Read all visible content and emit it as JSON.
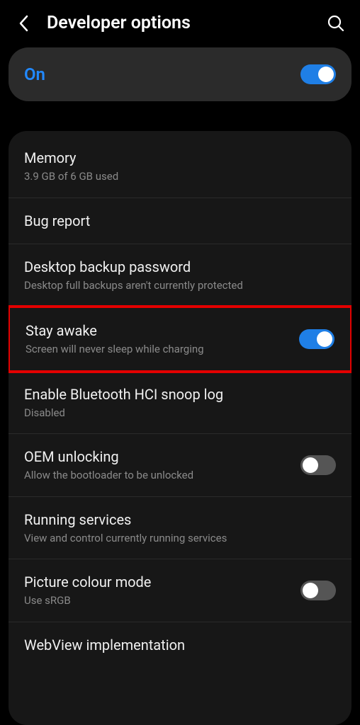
{
  "header": {
    "title": "Developer options"
  },
  "master": {
    "label": "On",
    "on": true
  },
  "items": [
    {
      "title": "Memory",
      "sub": "3.9 GB of 6 GB used",
      "toggle": null,
      "highlight": false
    },
    {
      "title": "Bug report",
      "sub": null,
      "toggle": null,
      "highlight": false
    },
    {
      "title": "Desktop backup password",
      "sub": "Desktop full backups aren't currently protected",
      "toggle": null,
      "highlight": false
    },
    {
      "title": "Stay awake",
      "sub": "Screen will never sleep while charging",
      "toggle": true,
      "highlight": true
    },
    {
      "title": "Enable Bluetooth HCI snoop log",
      "sub": "Disabled",
      "toggle": null,
      "highlight": false
    },
    {
      "title": "OEM unlocking",
      "sub": "Allow the bootloader to be unlocked",
      "toggle": false,
      "highlight": false
    },
    {
      "title": "Running services",
      "sub": "View and control currently running services",
      "toggle": null,
      "highlight": false
    },
    {
      "title": "Picture colour mode",
      "sub": "Use sRGB",
      "toggle": false,
      "highlight": false
    },
    {
      "title": "WebView implementation",
      "sub": null,
      "toggle": null,
      "highlight": false
    }
  ]
}
